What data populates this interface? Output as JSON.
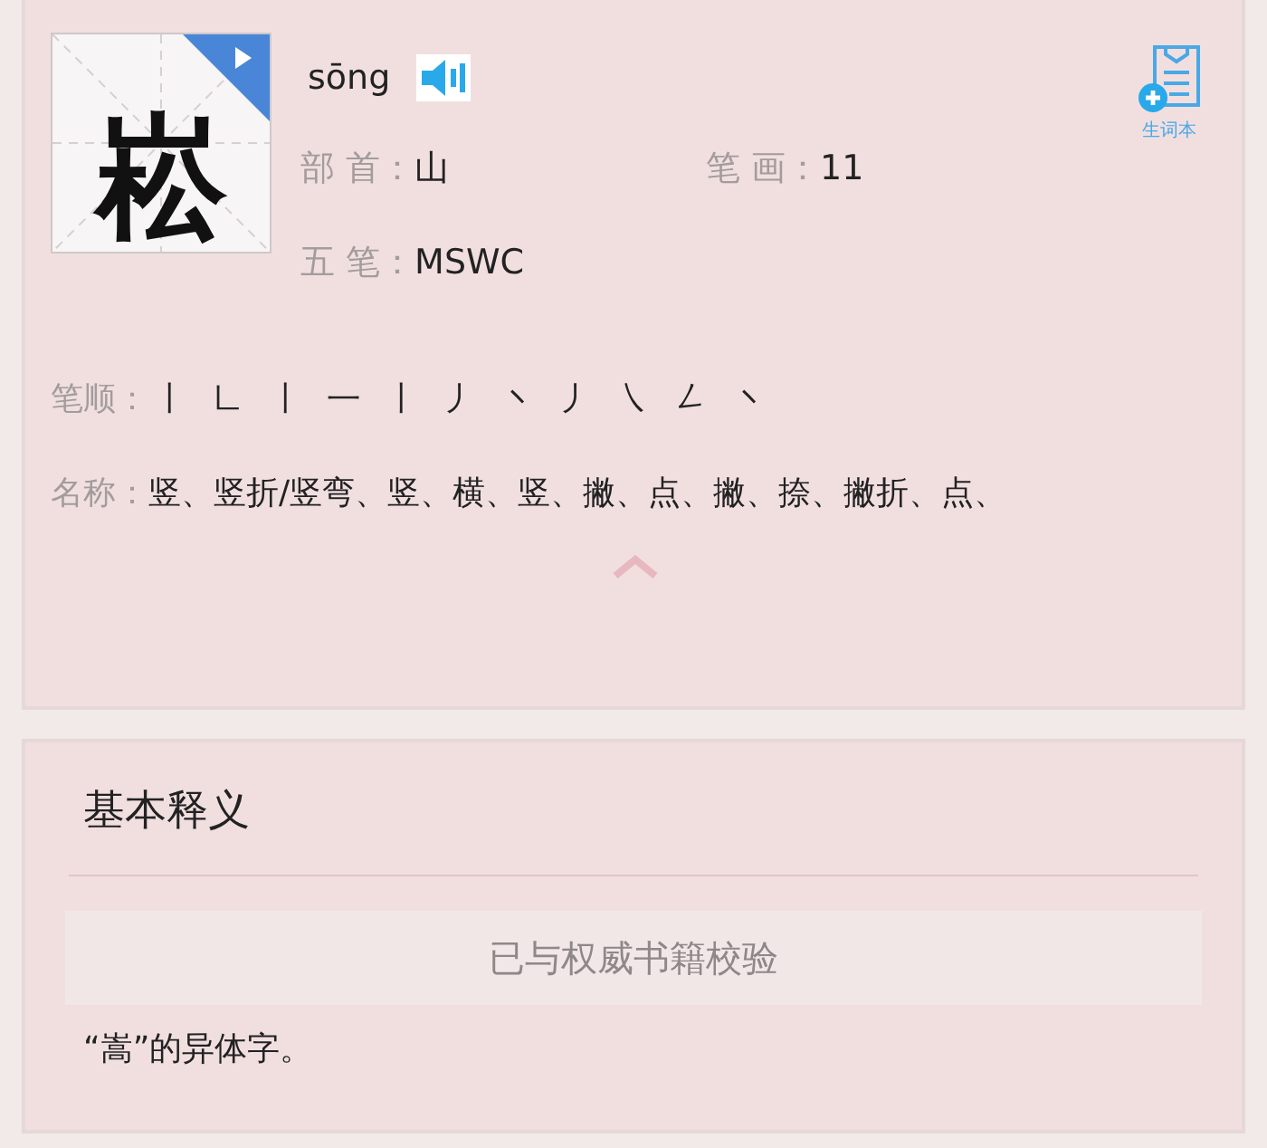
{
  "character": {
    "glyph": "崧",
    "pinyin": "sōng"
  },
  "vocab_button": {
    "label": "生词本"
  },
  "info": [
    {
      "label": "部 首：",
      "value": "山"
    },
    {
      "label": "笔 画：",
      "value": "11"
    },
    {
      "label": "五 笔：",
      "value": "MSWC"
    }
  ],
  "stroke_order": {
    "label": "笔顺：",
    "strokes": [
      "㇑",
      "㇗",
      "㇑",
      "㇐",
      "㇑",
      "㇓",
      "㇔",
      "㇓",
      "㇏",
      "㇜",
      "㇔"
    ]
  },
  "stroke_names": {
    "label": "名称：",
    "text": "竖、竖折/竖弯、竖、横、竖、撇、点、撇、捺、撇折、点、"
  },
  "definition": {
    "title": "基本释义",
    "verified": "已与权威书籍校验",
    "text": "“嵩”的异体字。"
  }
}
